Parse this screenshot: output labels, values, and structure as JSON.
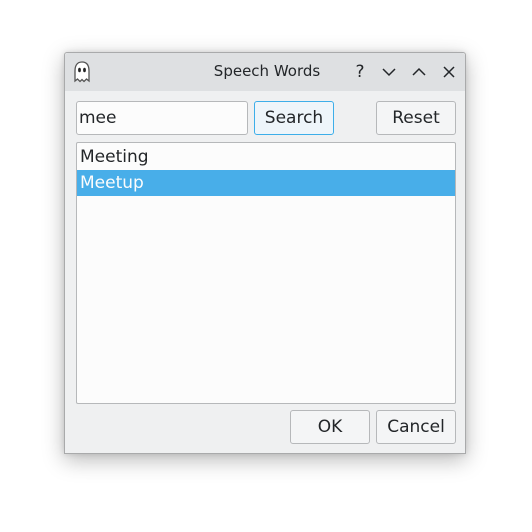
{
  "window": {
    "title": "Speech Words",
    "help_glyph": "?"
  },
  "search": {
    "value": "mee",
    "button_label": "Search"
  },
  "reset": {
    "label": "Reset"
  },
  "results": [
    {
      "label": "Meeting",
      "selected": false
    },
    {
      "label": "Meetup",
      "selected": true
    }
  ],
  "footer": {
    "ok_label": "OK",
    "cancel_label": "Cancel"
  },
  "colors": {
    "accent": "#3daee9",
    "selection": "#48aee9",
    "window_bg": "#eff0f1",
    "titlebar_bg": "#dee0e2"
  },
  "icons": {
    "app": "ghost-icon",
    "help": "help-icon",
    "minimize": "chevron-down-icon",
    "maximize": "chevron-up-icon",
    "close": "close-icon"
  }
}
